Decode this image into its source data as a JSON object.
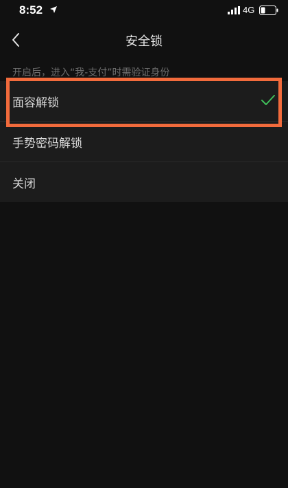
{
  "status_bar": {
    "time": "8:52",
    "network": "4G"
  },
  "nav": {
    "title": "安全锁"
  },
  "hint": "开启后，进入“我-支付”时需验证身份",
  "options": [
    {
      "label": "面容解锁",
      "selected": true
    },
    {
      "label": "手势密码解锁",
      "selected": false
    },
    {
      "label": "关闭",
      "selected": false
    }
  ],
  "colors": {
    "background": "#111111",
    "list_background": "#1c1c1c",
    "check": "#3fbf5a",
    "highlight": "#f26b3c"
  },
  "icons": {
    "location": "location-arrow-icon",
    "signal": "cellular-signal-icon",
    "battery": "battery-icon",
    "back": "chevron-left-icon",
    "selected": "checkmark-icon"
  }
}
